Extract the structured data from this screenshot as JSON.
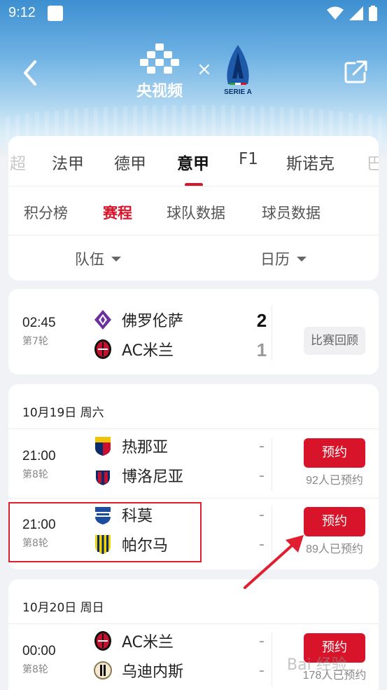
{
  "status": {
    "time": "9:12"
  },
  "header": {
    "brand": "央视频",
    "times": "×",
    "serie_a": "SERIE A"
  },
  "league_tabs": [
    "超",
    "法甲",
    "德甲",
    "意甲",
    "F1",
    "斯诺克",
    "巴"
  ],
  "sub_tabs": [
    "积分榜",
    "赛程",
    "球队数据",
    "球员数据"
  ],
  "filters": {
    "team": "队伍",
    "calendar": "日历"
  },
  "finished_match": {
    "time": "02:45",
    "round": "第7轮",
    "home": "佛罗伦萨",
    "away": "AC米兰",
    "home_score": "2",
    "away_score": "1",
    "action": "比赛回顾"
  },
  "day1": {
    "date": "10月19日 周六",
    "matches": [
      {
        "time": "21:00",
        "round": "第8轮",
        "home": "热那亚",
        "away": "博洛尼亚",
        "home_score": "-",
        "away_score": "-",
        "action": "预约",
        "reserve_count": "92人已预约"
      },
      {
        "time": "21:00",
        "round": "第8轮",
        "home": "科莫",
        "away": "帕尔马",
        "home_score": "-",
        "away_score": "-",
        "action": "预约",
        "reserve_count": "89人已预约"
      }
    ]
  },
  "day2": {
    "date": "10月20日 周日",
    "matches": [
      {
        "time": "00:00",
        "round": "第8轮",
        "home": "AC米兰",
        "away": "乌迪内斯",
        "home_score": "-",
        "away_score": "-",
        "action": "预约",
        "reserve_count": "178人已预约"
      }
    ]
  },
  "watermark": "Bai 经验",
  "colors": {
    "accent": "#d8142a",
    "header_sky": "#3d8fd0"
  }
}
